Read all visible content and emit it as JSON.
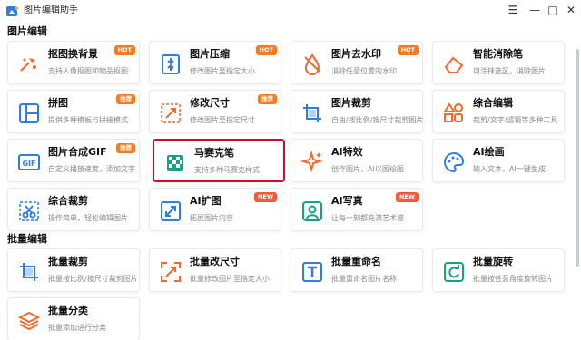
{
  "app": {
    "title": "图片编辑助手",
    "colors": {
      "accent": "#f77b20",
      "selected_border": "#c8102e",
      "icon_blue": "#2f7fe0",
      "icon_orange": "#f26a2e"
    }
  },
  "window": {
    "menu_icon": "hamburger-icon",
    "min_icon": "minimize-icon",
    "max_icon": "maximize-icon",
    "close_icon": "close-icon"
  },
  "sections": {
    "edit": "图片编辑",
    "batch": "批量编辑"
  },
  "edit_cards": [
    {
      "title": "抠图换背景",
      "desc": "支持人像抠图和物品抠图",
      "badge": "HOT",
      "icon": "cutout-icon"
    },
    {
      "title": "图片压缩",
      "desc": "修改图片至指定大小",
      "badge": "HOT",
      "icon": "compress-icon"
    },
    {
      "title": "图片去水印",
      "desc": "消除任意位置的水印",
      "badge": "HOT",
      "icon": "watermark-remove-icon"
    },
    {
      "title": "智能消除笔",
      "desc": "可涂抹选区，消除图片",
      "badge": "",
      "icon": "eraser-icon"
    },
    {
      "title": "拼图",
      "desc": "提供多种模板与拼接模式",
      "badge": "推荐",
      "icon": "collage-icon"
    },
    {
      "title": "修改尺寸",
      "desc": "修改图片至指定尺寸",
      "badge": "推荐",
      "icon": "resize-icon"
    },
    {
      "title": "图片裁剪",
      "desc": "自由/按比例/按尺寸裁剪图片",
      "badge": "",
      "icon": "crop-icon"
    },
    {
      "title": "综合编辑",
      "desc": "裁剪/文字/滤镜等多种工具",
      "badge": "",
      "icon": "tools-icon"
    },
    {
      "title": "图片合成GIF",
      "desc": "自定义播放速度，添加文字",
      "badge": "推荐",
      "icon": "gif-icon"
    },
    {
      "title": "马赛克笔",
      "desc": "支持多种马赛克样式",
      "badge": "",
      "icon": "mosaic-icon"
    },
    {
      "title": "AI特效",
      "desc": "创作图片，AI以图绘图",
      "badge": "",
      "icon": "sparkle-icon"
    },
    {
      "title": "AI绘画",
      "desc": "输入文本，AI一键生成",
      "badge": "",
      "icon": "palette-icon"
    },
    {
      "title": "综合裁剪",
      "desc": "操作简单，轻松编辑图片",
      "badge": "",
      "icon": "scissors-icon"
    },
    {
      "title": "AI扩图",
      "desc": "拓展图片内容",
      "badge": "NEW",
      "icon": "expand-icon"
    },
    {
      "title": "AI写真",
      "desc": "让每一刻都充满艺术感",
      "badge": "NEW",
      "icon": "portrait-icon"
    }
  ],
  "batch_cards": [
    {
      "title": "批量裁剪",
      "desc": "批量按比例/按尺寸裁剪图片",
      "icon": "batch-crop-icon"
    },
    {
      "title": "批量改尺寸",
      "desc": "批量修改图片至指定大小",
      "icon": "batch-resize-icon"
    },
    {
      "title": "批量重命名",
      "desc": "批量重命名图片名称",
      "icon": "rename-icon"
    },
    {
      "title": "批量旋转",
      "desc": "批量按任意角度旋转图片",
      "icon": "rotate-icon"
    },
    {
      "title": "批量分类",
      "desc": "批量添加进行分类",
      "icon": "layers-icon"
    }
  ]
}
